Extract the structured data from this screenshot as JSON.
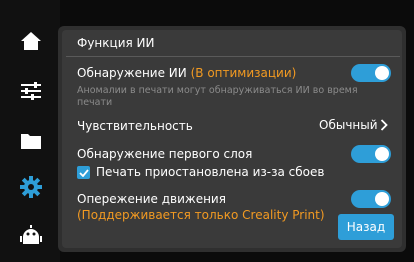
{
  "sidebar": {
    "items": [
      {
        "icon": "home-icon",
        "active": false
      },
      {
        "icon": "sliders-icon",
        "active": false
      },
      {
        "icon": "folder-icon",
        "active": false
      },
      {
        "icon": "gear-icon",
        "active": true
      },
      {
        "icon": "robot-icon",
        "active": false
      }
    ],
    "icon_color": "#ffffff",
    "active_color": "#2e9ed8"
  },
  "section": {
    "title": "Функция ИИ"
  },
  "ai_detection": {
    "label": "Обнаружение ИИ",
    "status": "(В оптимизации)",
    "hint": "Аномалии в печати могут обнаруживаться ИИ во время печати",
    "enabled": true
  },
  "sensitivity": {
    "label": "Чувствительность",
    "value": "Обычный"
  },
  "first_layer": {
    "label": "Обнаружение первого слоя",
    "enabled": true
  },
  "pause_on_failure": {
    "label": "Печать приостановлена из-за сбоев",
    "checked": true
  },
  "motion_advance": {
    "label": "Опережение движения",
    "note": "(Поддерживается только Creality Print)",
    "enabled": true
  },
  "back_button": {
    "label": "Назад"
  },
  "colors": {
    "accent": "#2e9ed8",
    "warning": "#f29a22",
    "panel": "#3a3a3a",
    "background": "#0b0b0b"
  }
}
